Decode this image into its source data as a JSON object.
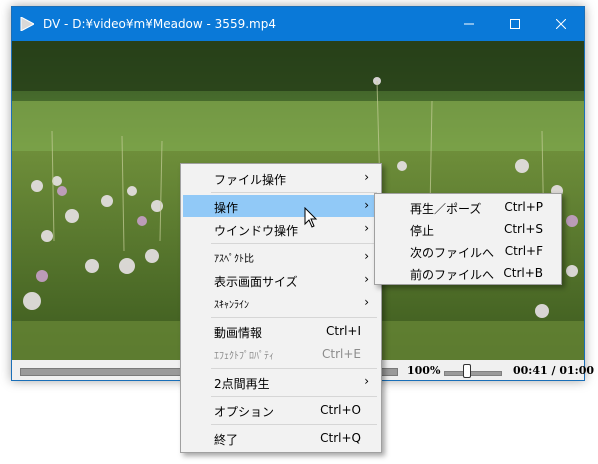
{
  "window": {
    "title": "DV - D:¥video¥m¥Meadow - 3559.mp4",
    "icons": {
      "app": "play-triangle-icon",
      "minimize": "minimize-icon",
      "maximize": "maximize-icon",
      "close": "close-icon"
    }
  },
  "controls": {
    "zoom": "100%",
    "time": "00:41 / 01:00",
    "volume_level": 0.4
  },
  "menu": {
    "items": [
      {
        "label": "ファイル操作",
        "submenu": true
      },
      {
        "label": "操作",
        "submenu": true,
        "highlighted": true
      },
      {
        "label": "ウインドウ操作",
        "submenu": true
      },
      {
        "label": "ｱｽﾍﾟｸﾄ比",
        "submenu": true
      },
      {
        "label": "表示画面サイズ",
        "submenu": true
      },
      {
        "label": "ｽｷｬﾝﾗｲﾝ",
        "submenu": true
      },
      {
        "label": "動画情報",
        "shortcut": "Ctrl+I"
      },
      {
        "label": "ｴﾌｪｸﾄﾌﾟﾛﾊﾟﾃｨ",
        "shortcut": "Ctrl+E",
        "disabled": true
      },
      {
        "label": "2点間再生",
        "submenu": true
      },
      {
        "label": "オプション",
        "shortcut": "Ctrl+O"
      },
      {
        "label": "終了",
        "shortcut": "Ctrl+Q"
      }
    ]
  },
  "submenu": {
    "items": [
      {
        "label": "再生／ポーズ",
        "shortcut": "Ctrl+P"
      },
      {
        "label": "停止",
        "shortcut": "Ctrl+S"
      },
      {
        "label": "次のファイルへ",
        "shortcut": "Ctrl+F"
      },
      {
        "label": "前のファイルへ",
        "shortcut": "Ctrl+B"
      }
    ]
  },
  "colors": {
    "titlebar": "#0a79d8",
    "highlight": "#91c9f7",
    "menu_bg": "#f2f2f2"
  }
}
